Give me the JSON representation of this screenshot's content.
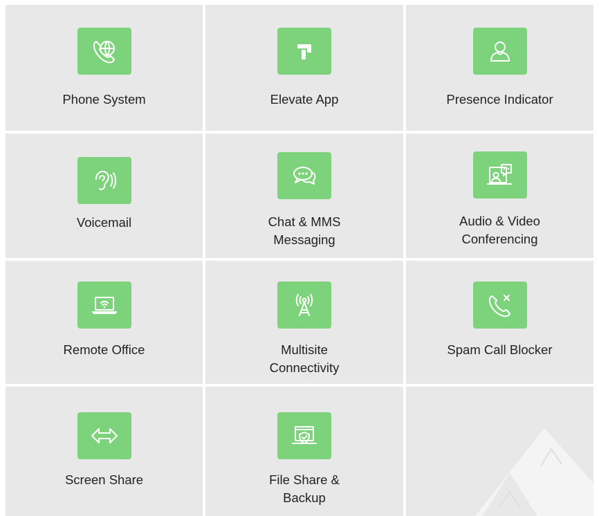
{
  "features": [
    {
      "label": "Phone System",
      "icon": "phone-globe-icon"
    },
    {
      "label": "Elevate App",
      "icon": "elevate-logo-icon"
    },
    {
      "label": "Presence Indicator",
      "icon": "user-icon"
    },
    {
      "label": "Voicemail",
      "icon": "ear-icon"
    },
    {
      "label": "Chat & MMS\nMessaging",
      "icon": "chat-bubbles-icon"
    },
    {
      "label": "Audio & Video\nConferencing",
      "icon": "video-conference-icon"
    },
    {
      "label": "Remote Office",
      "icon": "laptop-wifi-icon"
    },
    {
      "label": "Multisite\nConnectivity",
      "icon": "antenna-tower-icon"
    },
    {
      "label": "Spam Call Blocker",
      "icon": "phone-block-icon"
    },
    {
      "label": "Screen Share",
      "icon": "double-arrow-icon"
    },
    {
      "label": "File Share &\nBackup",
      "icon": "shield-check-icon"
    }
  ],
  "colors": {
    "cell_bg": "#e8e8e8",
    "icon_bg": "#7dd37b",
    "text": "#222222"
  }
}
